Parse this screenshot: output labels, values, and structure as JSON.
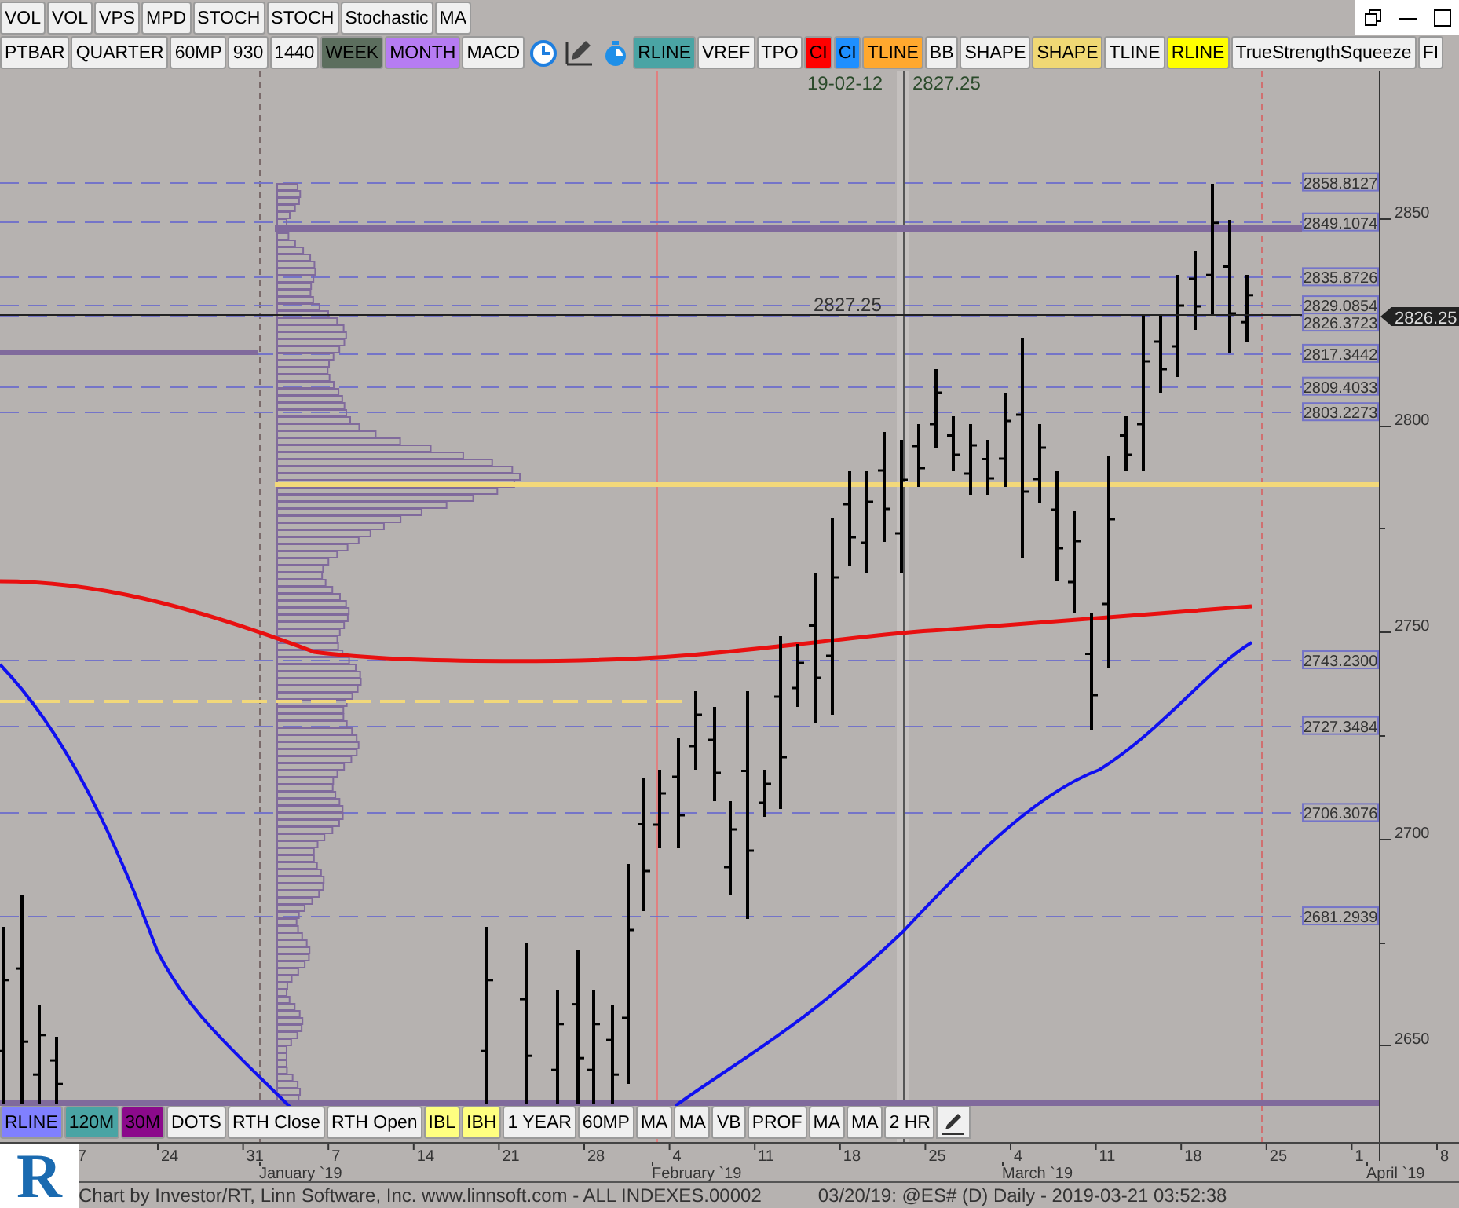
{
  "toolbar_top": {
    "buttons": [
      {
        "label": "VOL",
        "color": "#f0f0f0"
      },
      {
        "label": "VOL",
        "color": "#f0f0f0"
      },
      {
        "label": "VPS",
        "color": "#f0f0f0"
      },
      {
        "label": "MPD",
        "color": "#f0f0f0"
      },
      {
        "label": "STOCH",
        "color": "#f0f0f0"
      },
      {
        "label": "STOCH",
        "color": "#f0f0f0"
      },
      {
        "label": "Stochastic",
        "color": "#f0f0f0"
      },
      {
        "label": "MA",
        "color": "#f0f0f0"
      }
    ]
  },
  "toolbar_study": {
    "buttons_left": [
      {
        "label": "PTBAR",
        "color": "#f0f0f0"
      },
      {
        "label": "QUARTER",
        "color": "#f0f0f0"
      },
      {
        "label": "60MP",
        "color": "#f0f0f0"
      },
      {
        "label": "930",
        "color": "#f0f0f0"
      },
      {
        "label": "1440",
        "color": "#f0f0f0"
      },
      {
        "label": "WEEK",
        "color": "#5c6e5e"
      },
      {
        "label": "MONTH",
        "color": "#b67cf2"
      },
      {
        "label": "MACD",
        "color": "#f0f0f0"
      }
    ],
    "buttons_right": [
      {
        "label": "RLINE",
        "color": "#4aa4a4"
      },
      {
        "label": "VREF",
        "color": "#f0f0f0"
      },
      {
        "label": "TPO",
        "color": "#f0f0f0"
      },
      {
        "label": "CI",
        "color": "#ff0000"
      },
      {
        "label": "CI",
        "color": "#1e8fff"
      },
      {
        "label": "TLINE",
        "color": "#ffa82e"
      },
      {
        "label": "BB",
        "color": "#f0f0f0"
      },
      {
        "label": "SHAPE",
        "color": "#f0f0f0"
      },
      {
        "label": "SHAPE",
        "color": "#f0d874"
      },
      {
        "label": "TLINE",
        "color": "#f0f0f0"
      },
      {
        "label": "RLINE",
        "color": "#ffff00"
      },
      {
        "label": "TrueStrengthSqueeze",
        "color": "#f0f0f0"
      },
      {
        "label": "FI",
        "color": "#f0f0f0"
      }
    ]
  },
  "chart": {
    "header_date": "19-02-12",
    "header_price": "2827.25",
    "crosshair_price": "2827.25",
    "last_price": "2826.25",
    "price_axis": [
      "2850",
      "2800",
      "2750",
      "2700",
      "2650"
    ],
    "levels": [
      "2858.8127",
      "2849.1074",
      "2835.8726",
      "2829.0854",
      "2826.3723",
      "2817.3442",
      "2809.4033",
      "2803.2273",
      "2743.2300",
      "2727.3484",
      "2706.3076",
      "2681.2939"
    ]
  },
  "toolbar_bottom": {
    "buttons": [
      {
        "label": "RLINE",
        "color": "#8080ff"
      },
      {
        "label": "120M",
        "color": "#4aa4a4"
      },
      {
        "label": "30M",
        "color": "#8b0a8b"
      },
      {
        "label": "DOTS",
        "color": "#f0f0f0"
      },
      {
        "label": "RTH Close",
        "color": "#f0f0f0"
      },
      {
        "label": "RTH Open",
        "color": "#f0f0f0"
      },
      {
        "label": "IBL",
        "color": "#ffff80"
      },
      {
        "label": "IBH",
        "color": "#ffff80"
      },
      {
        "label": "1 YEAR",
        "color": "#f0f0f0"
      },
      {
        "label": "60MP",
        "color": "#f0f0f0"
      },
      {
        "label": "MA",
        "color": "#f0f0f0"
      },
      {
        "label": "MA",
        "color": "#f0f0f0"
      },
      {
        "label": "VB",
        "color": "#f0f0f0"
      },
      {
        "label": "PROF",
        "color": "#f0f0f0"
      },
      {
        "label": "MA",
        "color": "#f0f0f0"
      },
      {
        "label": "MA",
        "color": "#f0f0f0"
      },
      {
        "label": "2 HR",
        "color": "#f0f0f0"
      }
    ]
  },
  "date_axis": {
    "days": [
      "7",
      "24",
      "31",
      "7",
      "14",
      "21",
      "28",
      "4",
      "11",
      "18",
      "25",
      "4",
      "11",
      "18",
      "25",
      "1",
      "8"
    ],
    "months": [
      "January `19",
      "February `19",
      "March `19",
      "April `19"
    ]
  },
  "logo": "R",
  "footer": {
    "credit": "Chart by Investor/RT, Linn Software, Inc. www.linnsoft.com - ALL INDEXES.00002",
    "info": "03/20/19: @ES# (D) Daily - 2019-03-21 03:52:38"
  }
}
